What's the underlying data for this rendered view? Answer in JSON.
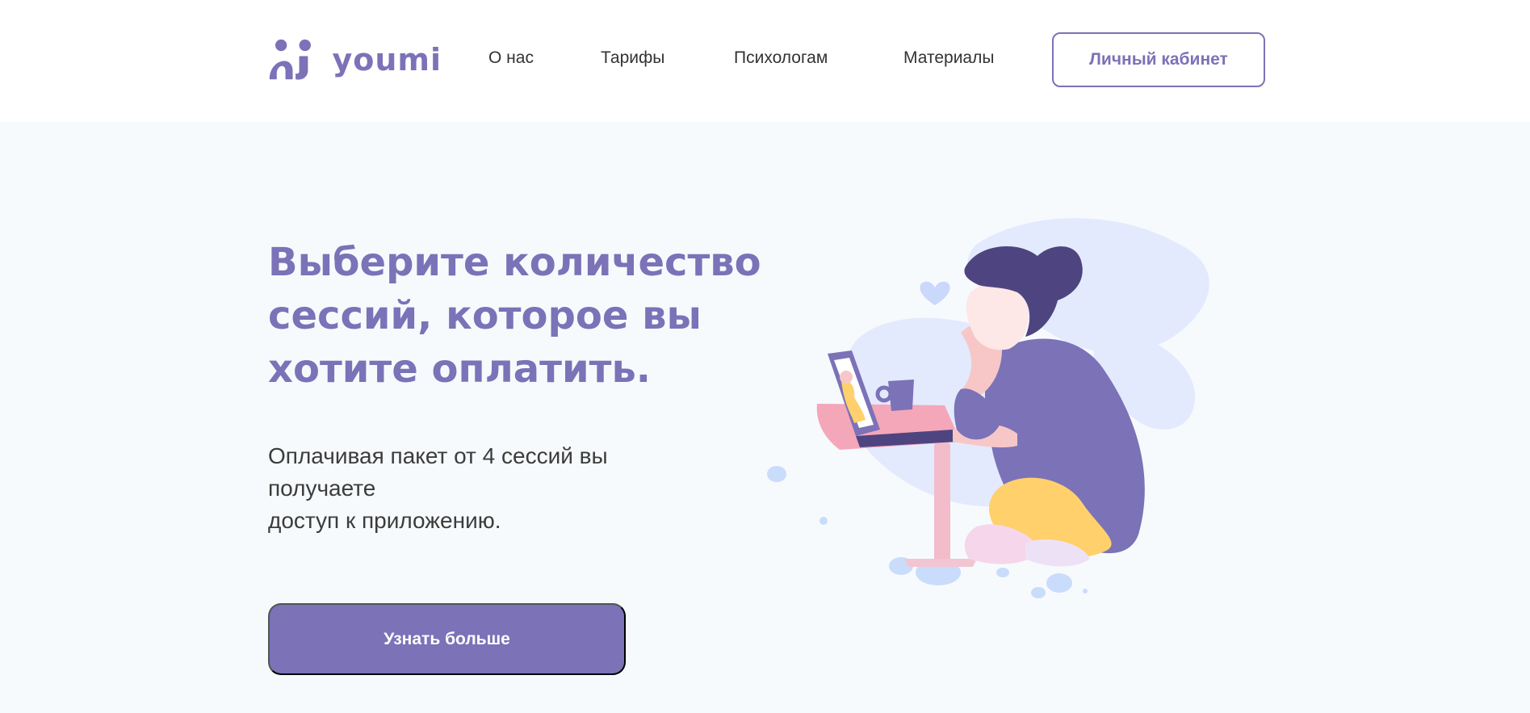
{
  "brand": {
    "name": "youmi",
    "color": "#7b72b8"
  },
  "nav": {
    "items": [
      {
        "label": "О нас"
      },
      {
        "label": "Тарифы"
      },
      {
        "label": "Психологам"
      },
      {
        "label": "Материалы"
      }
    ],
    "cabinet_label": "Личный кабинет"
  },
  "hero": {
    "title_lines": [
      "Выберите количество",
      "сессий, которое вы",
      "хотите оплатить."
    ],
    "subtitle_lines": [
      "Оплачивая пакет от 4 сессий вы",
      "получаете",
      "доступ к приложению."
    ],
    "cta_label": "Узнать больше"
  },
  "colors": {
    "accent": "#7b72b8",
    "dark_purple": "#4e4580",
    "yellow": "#ffd06b",
    "pink": "#f4a7b9",
    "light_blue": "#e4eafd",
    "background": "#f7fafc"
  }
}
